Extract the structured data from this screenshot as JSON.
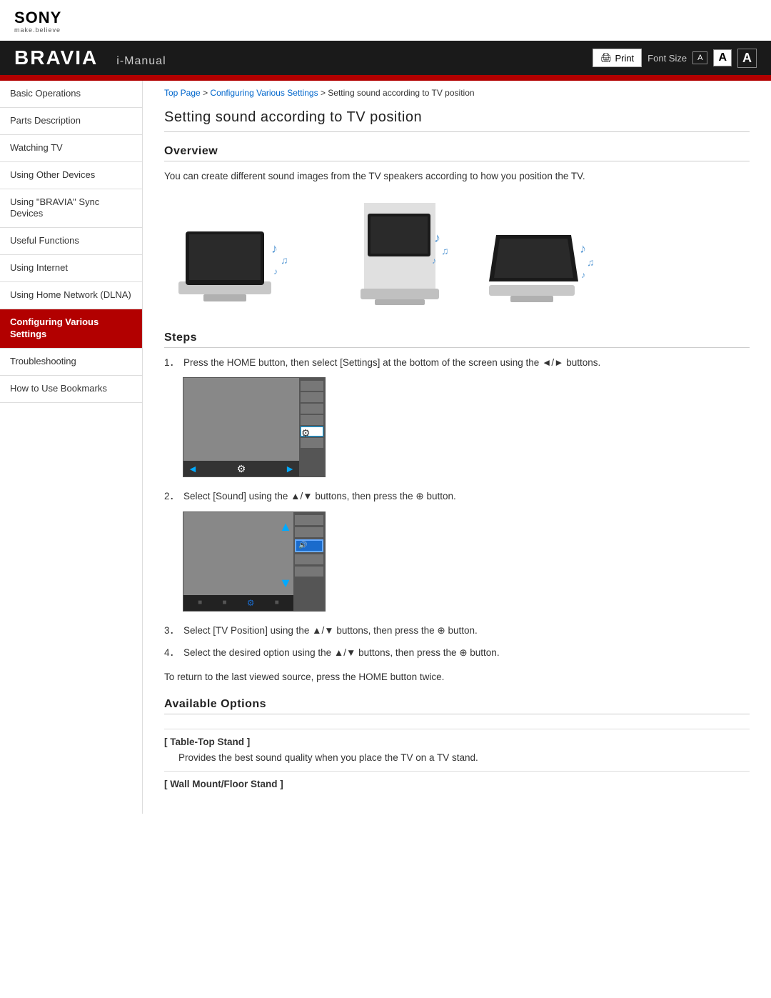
{
  "sony": {
    "logo": "SONY",
    "tagline": "make.believe"
  },
  "header": {
    "brand": "BRAVIA",
    "manual": "i-Manual",
    "print_label": "Print",
    "font_size_label": "Font Size",
    "font_sizes": [
      "A",
      "A",
      "A"
    ]
  },
  "breadcrumb": {
    "top_page": "Top Page",
    "separator1": " > ",
    "configuring": "Configuring Various Settings",
    "separator2": " > ",
    "current": "Setting sound according to TV position"
  },
  "page": {
    "title": "Setting sound according to TV position",
    "overview_heading": "Overview",
    "overview_text": "You can create different sound images from the TV speakers according to how you position the TV.",
    "steps_heading": "Steps",
    "steps": [
      {
        "num": "1．",
        "text": "Press the HOME button, then select  [Settings] at the bottom of the screen using the ◄/► buttons."
      },
      {
        "num": "2．",
        "text": "Select  [Sound] using the ▲/▼ buttons, then press the ⊕ button."
      },
      {
        "num": "3．",
        "text": "Select [TV Position] using the ▲/▼ buttons, then press the ⊕ button."
      },
      {
        "num": "4．",
        "text": "Select the desired option using the ▲/▼ buttons, then press the ⊕ button."
      }
    ],
    "return_note": "To return to the last viewed source, press the HOME button twice.",
    "available_heading": "Available Options",
    "options": [
      {
        "title": "[ Table-Top Stand ]",
        "desc": "Provides the best sound quality when you place the TV on a TV stand."
      },
      {
        "title": "[ Wall Mount/Floor Stand ]",
        "desc": ""
      }
    ]
  },
  "sidebar": {
    "items": [
      {
        "label": "Basic Operations",
        "active": false
      },
      {
        "label": "Parts Description",
        "active": false
      },
      {
        "label": "Watching TV",
        "active": false
      },
      {
        "label": "Using Other Devices",
        "active": false
      },
      {
        "label": "Using \"BRAVIA\" Sync Devices",
        "active": false
      },
      {
        "label": "Useful Functions",
        "active": false
      },
      {
        "label": "Using Internet",
        "active": false
      },
      {
        "label": "Using Home Network (DLNA)",
        "active": false
      },
      {
        "label": "Configuring Various Settings",
        "active": true
      },
      {
        "label": "Troubleshooting",
        "active": false
      },
      {
        "label": "How to Use Bookmarks",
        "active": false
      }
    ]
  }
}
